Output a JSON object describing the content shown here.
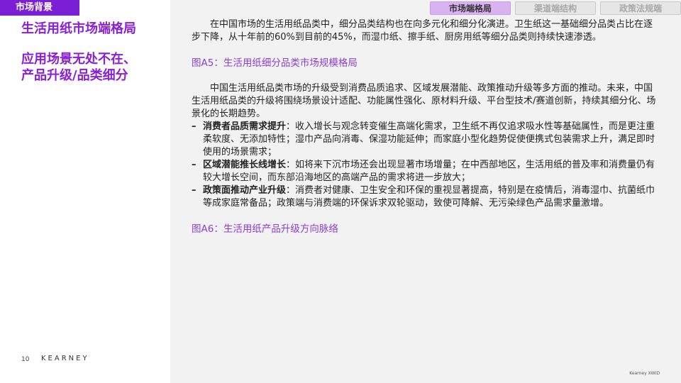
{
  "section_tag": "市场背景",
  "left": {
    "title": "生活用纸市场端格局",
    "subtitle_lines": [
      "应用场景无处不在、",
      "产品升级/品类细分"
    ]
  },
  "tabs": [
    {
      "label": "市场端格局",
      "active": true
    },
    {
      "label": "渠道端结构",
      "active": false
    },
    {
      "label": "政策法规端",
      "active": false
    }
  ],
  "content": {
    "para1": "在中国市场的生活用纸品类中，细分品类结构也在向多元化和细分化演进。卫生纸这一基础细分品类占比在逐步下降，从十年前的60%到目前的45%，而湿巾纸、擦手纸、厨房用纸等细分品类则持续快速渗透。",
    "fig_a5": "图A5：生活用纸细分品类市场规模格局",
    "para2": "中国生活用纸品类市场的升级受到消费品质追求、区域发展潜能、政策推动升级等多方面的推动。未来，中国生活用纸品类的升级将围绕场景设计适配、功能属性强化、原材料升级、平台型技术/赛道创新，持续其细分化、场景化的长期趋势。",
    "bullets": [
      {
        "key": "消费者品质需求提升",
        "text": "：收入增长与观念转变催生高端化需求，卫生纸不再仅追求吸水性等基础属性，而是更注重柔软度、无添加特性；湿巾产品向消毒、保湿功能延伸；而家庭小型化趋势促使便携式包装需求上升，满足即时使用的场景需求；"
      },
      {
        "key": "区域潜能推长线增长",
        "text": "：如将来下沉市场还会出现显著市场增量；在中西部地区，生活用纸的普及率和消费量仍有较大增长空间，而东部沿海地区的高端产品的需求将进一步放大；"
      },
      {
        "key": "政策面推动产业升级",
        "text": "：消费者对健康、卫生安全和环保的重视显著提高，特别是在疫情后，消毒湿巾、抗菌纸巾等成家庭常备品；政策端与消费端的环保诉求双轮驱动，致使可降解、无污染绿色产品需求量激增。"
      }
    ],
    "bullet_dash": "–",
    "fig_a6": "图A6：生活用纸产品升级方向脉络"
  },
  "footer": {
    "page_number": "10",
    "logo": "KEARNEY",
    "note": "Kearney XWID"
  }
}
